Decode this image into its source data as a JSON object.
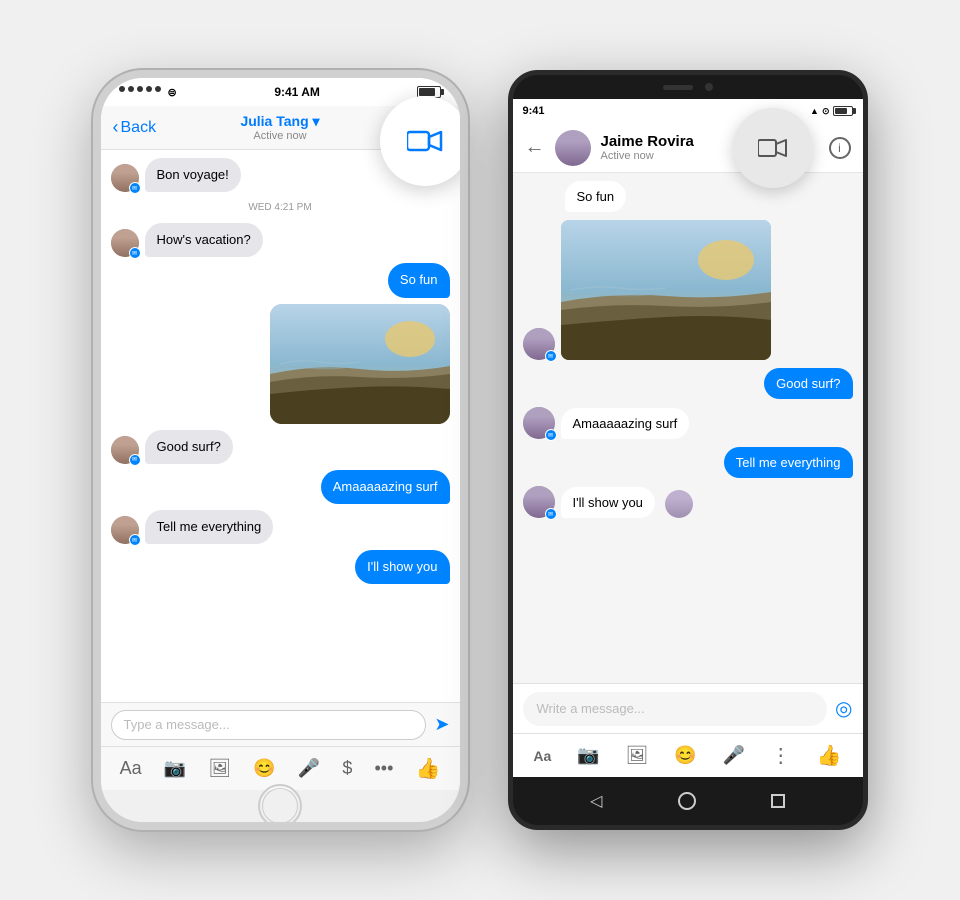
{
  "iphone": {
    "status_bar": {
      "signal": "●●●●●",
      "wifi": "WiFi",
      "time": "9:41 AM",
      "battery_pct": "100%"
    },
    "nav": {
      "back_label": "Back",
      "contact_name": "Julia Tang ▾",
      "status": "Active now"
    },
    "messages": [
      {
        "id": "msg1",
        "type": "received",
        "text": "Bon voyage!",
        "has_avatar": true
      },
      {
        "id": "date1",
        "type": "date",
        "text": "WED 4:21 PM"
      },
      {
        "id": "msg2",
        "type": "received",
        "text": "How's vacation?",
        "has_avatar": true
      },
      {
        "id": "msg3",
        "type": "sent",
        "text": "So fun"
      },
      {
        "id": "msg4",
        "type": "sent_photo"
      },
      {
        "id": "msg5",
        "type": "received",
        "text": "Good surf?",
        "has_avatar": true
      },
      {
        "id": "msg6",
        "type": "sent",
        "text": "Amaaaaazing surf"
      },
      {
        "id": "msg7",
        "type": "received",
        "text": "Tell me everything",
        "has_avatar": true
      },
      {
        "id": "msg8",
        "type": "sent",
        "text": "I'll show you"
      }
    ],
    "input": {
      "placeholder": "Type a message..."
    },
    "toolbar": {
      "aa": "Aa",
      "camera": "📷",
      "photos": "🖼",
      "emoji": "😊",
      "mic": "🎤",
      "dollar": "$",
      "more": "•••",
      "thumb": "👍"
    }
  },
  "android": {
    "status_bar": {
      "time": "9:41",
      "icons": "▲ WiFi 🔋"
    },
    "nav": {
      "back": "←",
      "contact_name": "Jaime Rovira",
      "status": "Active now"
    },
    "messages": [
      {
        "id": "amsg1",
        "type": "received",
        "text": "So fun",
        "has_avatar": false
      },
      {
        "id": "amsg2",
        "type": "received_photo",
        "has_avatar": true
      },
      {
        "id": "amsg3",
        "type": "sent",
        "text": "Good surf?"
      },
      {
        "id": "amsg4",
        "type": "received",
        "text": "Amaaaaazing surf",
        "has_avatar": true
      },
      {
        "id": "amsg5",
        "type": "sent",
        "text": "Tell me everything"
      },
      {
        "id": "amsg6",
        "type": "received",
        "text": "I'll show you",
        "has_avatar": true
      }
    ],
    "input": {
      "placeholder": "Write a message..."
    },
    "toolbar": {
      "aa": "Aa",
      "camera": "📷",
      "photos": "🖼",
      "emoji": "😊",
      "mic": "🎤",
      "more": "⋮",
      "thumb": "👍"
    }
  }
}
